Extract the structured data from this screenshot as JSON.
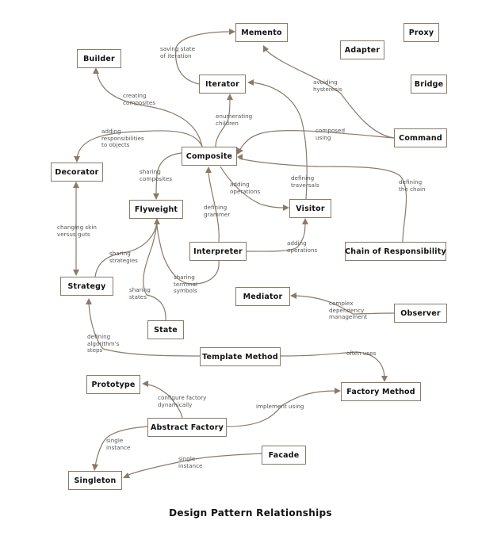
{
  "title": "Design Pattern Relationships",
  "colors": {
    "edge": "#8c7a68",
    "node_border": "#8c7a68",
    "text": "#111111",
    "label": "#555555",
    "background": "#ffffff"
  },
  "nodes": [
    {
      "id": "memento",
      "label": "Memento"
    },
    {
      "id": "proxy",
      "label": "Proxy"
    },
    {
      "id": "builder",
      "label": "Builder"
    },
    {
      "id": "adapter",
      "label": "Adapter"
    },
    {
      "id": "iterator",
      "label": "Iterator"
    },
    {
      "id": "bridge",
      "label": "Bridge"
    },
    {
      "id": "command",
      "label": "Command"
    },
    {
      "id": "composite",
      "label": "Composite"
    },
    {
      "id": "decorator",
      "label": "Decorator"
    },
    {
      "id": "flyweight",
      "label": "Flyweight"
    },
    {
      "id": "visitor",
      "label": "Visitor"
    },
    {
      "id": "interpreter",
      "label": "Interpreter"
    },
    {
      "id": "chain",
      "label": "Chain of Responsibility"
    },
    {
      "id": "strategy",
      "label": "Strategy"
    },
    {
      "id": "mediator",
      "label": "Mediator"
    },
    {
      "id": "observer",
      "label": "Observer"
    },
    {
      "id": "state",
      "label": "State"
    },
    {
      "id": "template",
      "label": "Template Method"
    },
    {
      "id": "prototype",
      "label": "Prototype"
    },
    {
      "id": "factorymethod",
      "label": "Factory Method"
    },
    {
      "id": "abstractfactory",
      "label": "Abstract Factory"
    },
    {
      "id": "facade",
      "label": "Facade"
    },
    {
      "id": "singleton",
      "label": "Singleton"
    }
  ],
  "edges": [
    {
      "from": "iterator",
      "to": "memento",
      "label": "saving state\nof iteration"
    },
    {
      "from": "composite",
      "to": "builder",
      "label": "creating\ncomposites"
    },
    {
      "from": "composite",
      "to": "iterator",
      "label": "enumerating\nchildren"
    },
    {
      "from": "command",
      "to": "memento",
      "label": "avoiding\nhysteresis"
    },
    {
      "from": "command",
      "to": "composite",
      "label": "composed\nusing"
    },
    {
      "from": "composite",
      "to": "decorator",
      "label": "adding\nresponsibilities\nto objects"
    },
    {
      "from": "composite",
      "to": "flyweight",
      "label": "sharing\ncomposites"
    },
    {
      "from": "composite",
      "to": "visitor",
      "label": "adding\noperations"
    },
    {
      "from": "visitor",
      "to": "iterator",
      "label": "defining\ntraversals"
    },
    {
      "from": "chain",
      "to": "composite",
      "label": "defining\nthe chain"
    },
    {
      "from": "interpreter",
      "to": "composite",
      "label": "defining\ngrammer"
    },
    {
      "from": "interpreter",
      "to": "visitor",
      "label": "adding\noperations"
    },
    {
      "from": "interpreter",
      "to": "flyweight",
      "label": "sharing\nterminal\nsymbols"
    },
    {
      "from": "decorator",
      "to": "strategy",
      "label": "changing skin\nversus guts",
      "bidirectional": true
    },
    {
      "from": "strategy",
      "to": "flyweight",
      "label": "sharing\nstrategies"
    },
    {
      "from": "state",
      "to": "flyweight",
      "label": "sharing\nstates"
    },
    {
      "from": "observer",
      "to": "mediator",
      "label": "complex\ndependency\nmanagement"
    },
    {
      "from": "template",
      "to": "strategy",
      "label": "defining\nalgorithm's\nsteps"
    },
    {
      "from": "template",
      "to": "factorymethod",
      "label": "often uses"
    },
    {
      "from": "abstractfactory",
      "to": "prototype",
      "label": "configure factory\ndynamically"
    },
    {
      "from": "abstractfactory",
      "to": "factorymethod",
      "label": "implement using"
    },
    {
      "from": "abstractfactory",
      "to": "singleton",
      "label": "single\ninstance"
    },
    {
      "from": "facade",
      "to": "singleton",
      "label": "single\ninstance"
    }
  ]
}
